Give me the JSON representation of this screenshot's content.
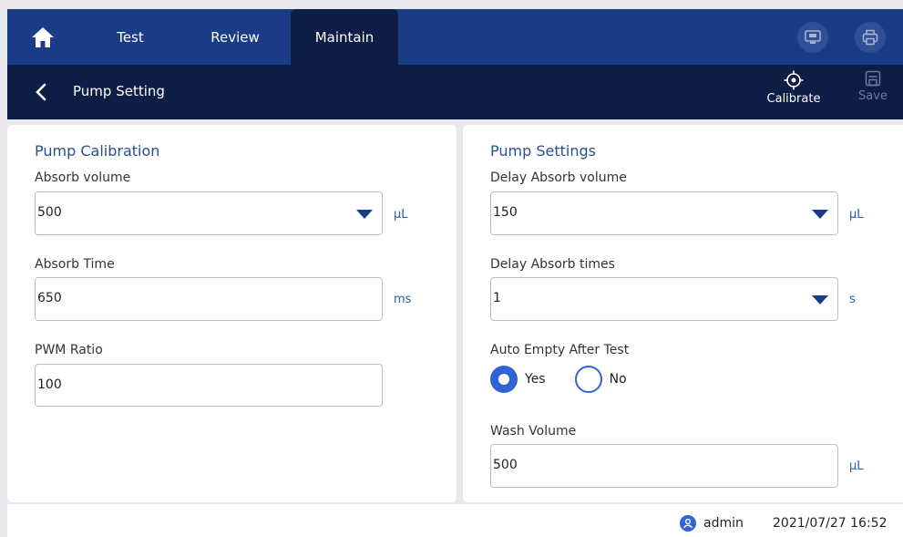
{
  "nav": {
    "tabs": [
      {
        "label": "Test"
      },
      {
        "label": "Review"
      },
      {
        "label": "Maintain",
        "active": true
      }
    ],
    "icons": {
      "home": "home-icon",
      "lis": "lis-monitor-icon",
      "print": "printer-icon"
    }
  },
  "subheader": {
    "title": "Pump Setting",
    "calibrate_label": "Calibrate",
    "save_label": "Save"
  },
  "left_panel": {
    "title": "Pump Calibration",
    "absorb_volume": {
      "label": "Absorb volume",
      "value": "500",
      "unit": "μL"
    },
    "absorb_time": {
      "label": "Absorb Time",
      "value": "650",
      "unit": "ms"
    },
    "pwm_ratio": {
      "label": "PWM Ratio",
      "value": "100"
    }
  },
  "right_panel": {
    "title": "Pump Settings",
    "delay_absorb_volume": {
      "label": "Delay Absorb volume",
      "value": "150",
      "unit": "μL"
    },
    "delay_absorb_times": {
      "label": "Delay Absorb times",
      "value": "1",
      "unit": "s"
    },
    "auto_empty": {
      "label": "Auto Empty After Test",
      "yes_label": "Yes",
      "no_label": "No",
      "selected": "Yes"
    },
    "wash_volume": {
      "label": "Wash Volume",
      "value": "500",
      "unit": "μL"
    }
  },
  "status": {
    "user": "admin",
    "datetime": "2021/07/27 16:52"
  },
  "colors": {
    "nav_bg": "#1a3b86",
    "subheader_bg": "#0d1d46",
    "accent": "#2f63d8",
    "section_title": "#2c4f8f"
  }
}
